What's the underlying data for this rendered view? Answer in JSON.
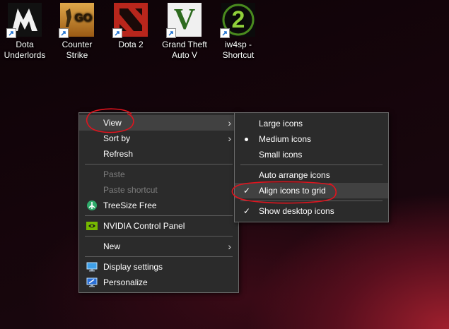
{
  "desktop": {
    "icons": [
      {
        "label": "Dota\nUnderlords",
        "icon": "dota-underlords-icon"
      },
      {
        "label": "Counter\nStrike",
        "icon": "counter-strike-icon",
        "tile_text": "GO"
      },
      {
        "label": "Dota 2",
        "icon": "dota2-icon"
      },
      {
        "label": "Grand Theft\nAuto V",
        "icon": "gta-v-icon",
        "tile_text": "V"
      },
      {
        "label": "iw4sp -\nShortcut",
        "icon": "iw4sp-icon",
        "tile_text": "2"
      }
    ]
  },
  "context_menu": {
    "items": [
      {
        "label": "View",
        "has_submenu": true,
        "state": "highlighted"
      },
      {
        "label": "Sort by",
        "has_submenu": true
      },
      {
        "label": "Refresh"
      },
      {
        "label": "Paste",
        "disabled": true
      },
      {
        "label": "Paste shortcut",
        "disabled": true
      },
      {
        "label": "TreeSize Free",
        "icon": "treesize-icon"
      },
      {
        "label": "NVIDIA Control Panel",
        "icon": "nvidia-icon"
      },
      {
        "label": "New",
        "has_submenu": true
      },
      {
        "label": "Display settings",
        "icon": "display-icon"
      },
      {
        "label": "Personalize",
        "icon": "personalize-icon"
      }
    ]
  },
  "view_submenu": {
    "items": [
      {
        "label": "Large icons"
      },
      {
        "label": "Medium icons",
        "selected": true
      },
      {
        "label": "Small icons"
      },
      {
        "label": "Auto arrange icons"
      },
      {
        "label": "Align icons to grid",
        "checked": true,
        "state": "highlighted"
      },
      {
        "label": "Show desktop icons",
        "checked": true
      }
    ]
  },
  "annotation_color": "#e0141e"
}
